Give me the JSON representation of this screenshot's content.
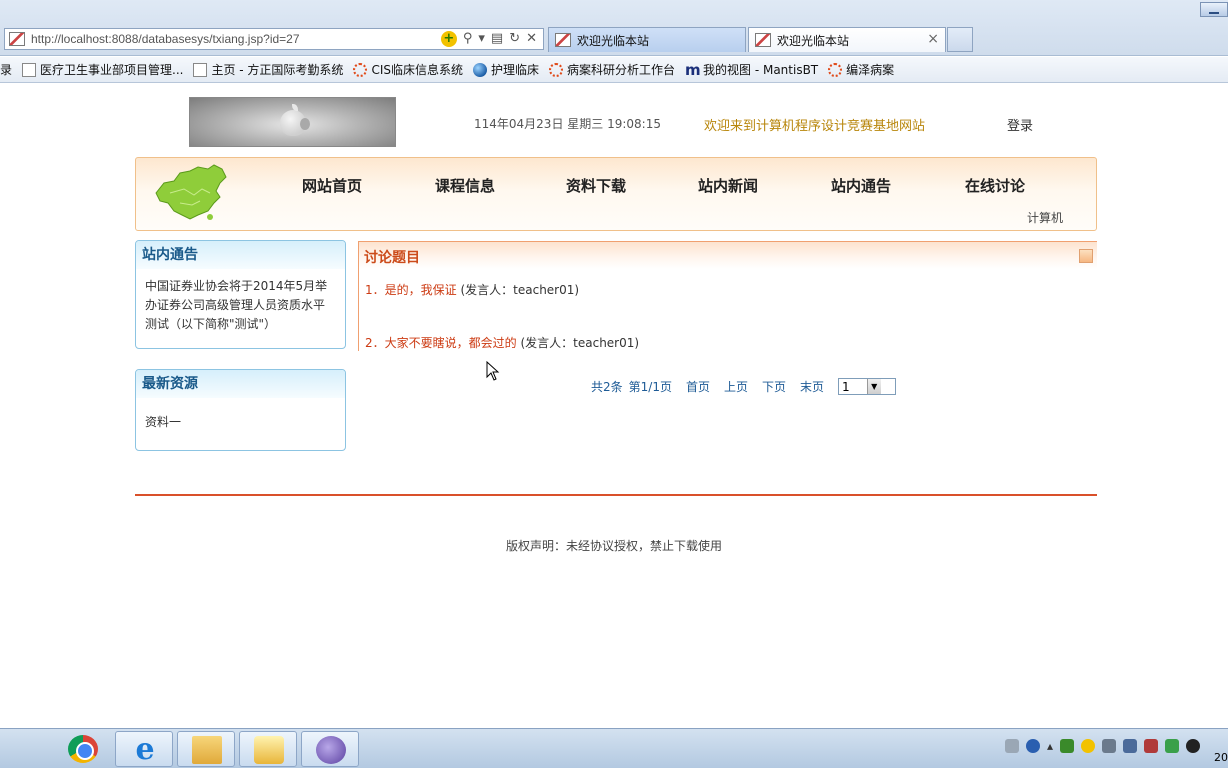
{
  "browser": {
    "url": "http://localhost:8088/databasesys/txiang.jsp?id=27",
    "tabs": [
      {
        "label": "欢迎光临本站"
      },
      {
        "label": "欢迎光临本站"
      }
    ],
    "tab_close": "×",
    "favorites": [
      {
        "label": "录",
        "icon": "none"
      },
      {
        "label": "医疗卫生事业部项目管理...",
        "icon": "ie-page-icon"
      },
      {
        "label": "主页 - 方正国际考勤系统",
        "icon": "ie-page-icon"
      },
      {
        "label": "CIS临床信息系统",
        "icon": "spinner-icon"
      },
      {
        "label": "护理临床",
        "icon": "globe-icon"
      },
      {
        "label": "病案科研分析工作台",
        "icon": "spinner-icon"
      },
      {
        "label": "我的视图 - MantisBT",
        "icon": "mantis-m-icon"
      },
      {
        "label": "编泽病案",
        "icon": "spinner-icon"
      }
    ]
  },
  "header": {
    "datetime": "114年04月23日 星期三 19:08:15",
    "welcome": "欢迎来到计算机程序设计竞赛基地网站",
    "login": "登录"
  },
  "nav": {
    "items": [
      "网站首页",
      "课程信息",
      "资料下载",
      "站内新闻",
      "站内通告",
      "在线讨论"
    ],
    "sub": "计算机"
  },
  "sidebar": {
    "notice": {
      "title": "站内通告",
      "text": "中国证券业协会将于2014年5月举办证券公司高级管理人员资质水平测试（以下简称\"测试\"）"
    },
    "resources": {
      "title": "最新资源",
      "items": [
        "资料一"
      ]
    }
  },
  "discussion": {
    "title": "讨论题目",
    "topics": [
      {
        "title": "1．是的，我保证",
        "author": "(发言人：teacher01)"
      },
      {
        "title": "2．大家不要瞎说，都会过的",
        "author": "(发言人：teacher01)"
      }
    ]
  },
  "pager": {
    "count": "共2条",
    "page": "第1/1页",
    "first": "首页",
    "prev": "上页",
    "next": "下页",
    "last": "末页",
    "selected": "1"
  },
  "footer": {
    "copyright": "版权声明：未经协议授权，禁止下载使用"
  },
  "taskbar": {
    "apps": [
      "chrome-icon",
      "ie-icon",
      "folder-icon",
      "mail-icon",
      "eclipse-icon"
    ],
    "clock": "20"
  },
  "colors": {
    "accent_red": "#cc3a12",
    "link_blue": "#1e5b96",
    "welcome_gold": "#b8860b",
    "box_border": "#8cc4e2"
  }
}
